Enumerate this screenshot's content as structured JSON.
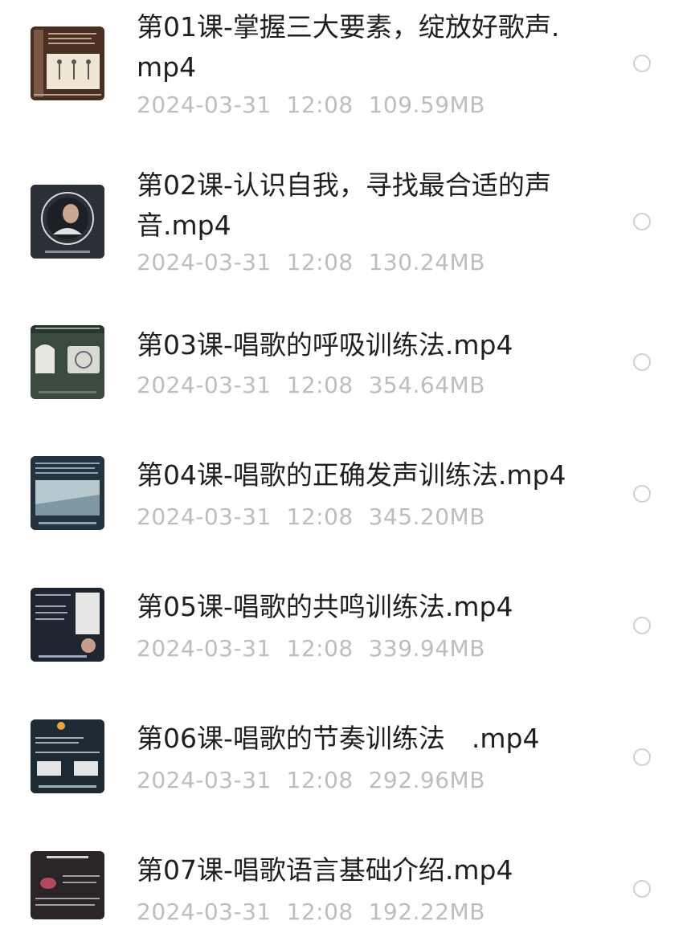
{
  "files": [
    {
      "name": "第01课-掌握三大要素，绽放好歌声.mp4",
      "date": "2024-03-31",
      "time": "12:08",
      "size": "109.59MB"
    },
    {
      "name": "第02课-认识自我，寻找最合适的声音.mp4",
      "date": "2024-03-31",
      "time": "12:08",
      "size": "130.24MB"
    },
    {
      "name": "第03课-唱歌的呼吸训练法.mp4",
      "date": "2024-03-31",
      "time": "12:08",
      "size": "354.64MB"
    },
    {
      "name": "第04课-唱歌的正确发声训练法.mp4",
      "date": "2024-03-31",
      "time": "12:08",
      "size": "345.20MB"
    },
    {
      "name": "第05课-唱歌的共鸣训练法.mp4",
      "date": "2024-03-31",
      "time": "12:08",
      "size": "339.94MB"
    },
    {
      "name": "第06课-唱歌的节奏训练法　.mp4",
      "date": "2024-03-31",
      "time": "12:08",
      "size": "292.96MB"
    },
    {
      "name": "第07课-唱歌语言基础介绍.mp4",
      "date": "2024-03-31",
      "time": "12:08",
      "size": "192.22MB"
    }
  ]
}
